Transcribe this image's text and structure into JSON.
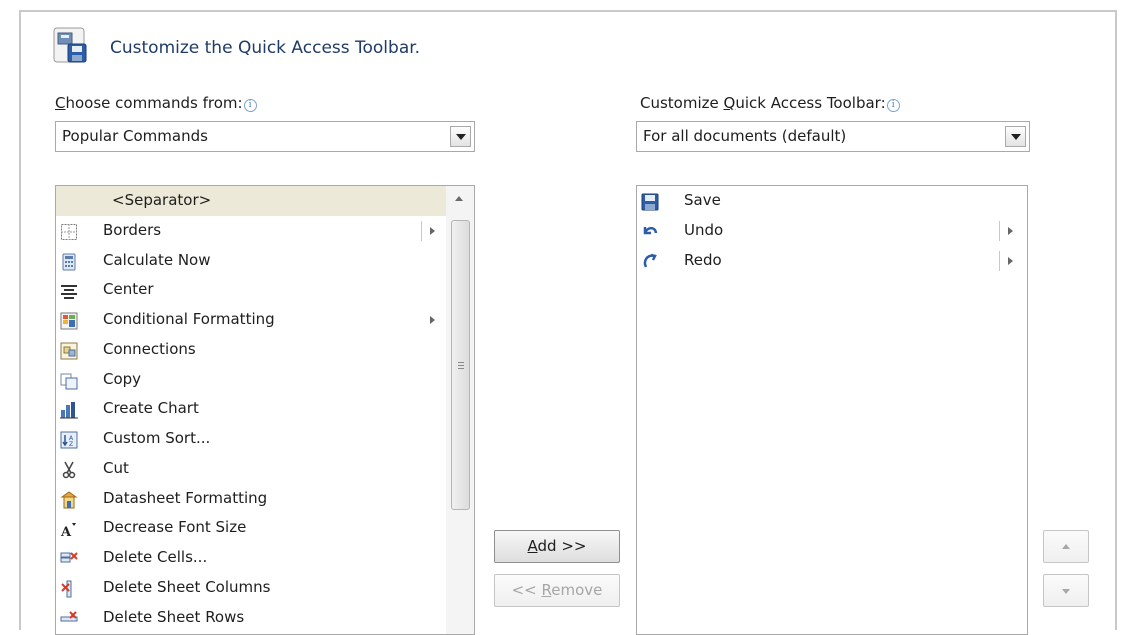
{
  "header": {
    "title": "Customize the Quick Access Toolbar.",
    "icon": "toolbar-save-icon"
  },
  "left": {
    "label_pre": "",
    "label_accel": "C",
    "label_post": "hoose commands from:",
    "info": "i",
    "dropdown_value": "Popular Commands",
    "items": [
      {
        "label": "<Separator>",
        "icon": "separator",
        "selected": true
      },
      {
        "label": "Borders",
        "icon": "borders-icon",
        "submenu": true,
        "submenu_divider": true
      },
      {
        "label": "Calculate Now",
        "icon": "calculator-icon"
      },
      {
        "label": "Center",
        "icon": "align-center-icon"
      },
      {
        "label": "Conditional Formatting",
        "icon": "conditional-formatting-icon",
        "submenu": true
      },
      {
        "label": "Connections",
        "icon": "connections-icon"
      },
      {
        "label": "Copy",
        "icon": "copy-icon"
      },
      {
        "label": "Create Chart",
        "icon": "chart-icon"
      },
      {
        "label": "Custom Sort...",
        "icon": "sort-icon"
      },
      {
        "label": "Cut",
        "icon": "scissors-icon"
      },
      {
        "label": "Datasheet Formatting",
        "icon": "datasheet-formatting-icon"
      },
      {
        "label": "Decrease Font Size",
        "icon": "decrease-font-icon"
      },
      {
        "label": "Delete Cells...",
        "icon": "delete-cells-icon"
      },
      {
        "label": "Delete Sheet Columns",
        "icon": "delete-columns-icon"
      },
      {
        "label": "Delete Sheet Rows",
        "icon": "delete-rows-icon"
      }
    ]
  },
  "right": {
    "label_pre": "Customize ",
    "label_accel": "Q",
    "label_post": "uick Access Toolbar:",
    "info": "i",
    "dropdown_value": "For all documents (default)",
    "items": [
      {
        "label": "Save",
        "icon": "save-icon"
      },
      {
        "label": "Undo",
        "icon": "undo-icon",
        "submenu": true,
        "submenu_divider": true
      },
      {
        "label": "Redo",
        "icon": "redo-icon",
        "submenu": true,
        "submenu_divider": true
      }
    ]
  },
  "buttons": {
    "add_accel": "A",
    "add_rest": "dd >>",
    "remove_pre": "<< ",
    "remove_accel": "R",
    "remove_rest": "emove"
  },
  "colors": {
    "accent": "#1f3b68",
    "selection": "#ece9d8",
    "border": "#a9a9a9"
  }
}
